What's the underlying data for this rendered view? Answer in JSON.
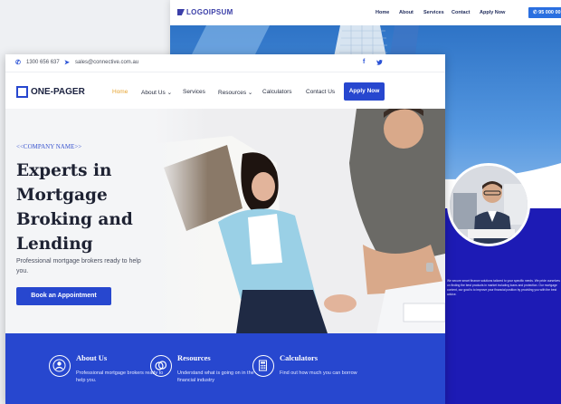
{
  "back_site": {
    "logo": "LOGOIPSUM",
    "nav": [
      "Home",
      "About",
      "Services",
      "Contact",
      "Apply Now"
    ],
    "phone": "95 000 00",
    "body_copy": "We secure smart finance solutions tailored to your specific needs. We pride ourselves on finding the best products in market including loans and protection. Our mortgage content, our goal is to improve your financial position by providing you with the best advice."
  },
  "topbar": {
    "phone": "1300 656 637",
    "email": "sales@connective.com.au",
    "facebook_icon": "f",
    "twitter_icon": "twitter-bird"
  },
  "nav": {
    "logo": "ONE-PAGER",
    "home": "Home",
    "about": "About Us",
    "services": "Services",
    "resources": "Resources",
    "calculators": "Calculators",
    "contact": "Contact Us",
    "apply": "Apply Now"
  },
  "hero": {
    "eyebrow": "<<COMPANY NAME>>",
    "headline": "Experts in Mortgage Broking and Lending",
    "subtext": "Professional mortgage brokers ready to help you.",
    "cta": "Book an Appointment"
  },
  "features": [
    {
      "title": "About Us",
      "desc": "Professional mortgage brokers ready to help you.",
      "icon": "user-icon"
    },
    {
      "title": "Resources",
      "desc": "Understand what is going on in the financial industry",
      "icon": "coins-icon"
    },
    {
      "title": "Calculators",
      "desc": "Find out how much you can borrow",
      "icon": "calculator-icon"
    }
  ],
  "colors": {
    "brand_blue": "#2747cf",
    "accent_orange": "#e6a431",
    "back_indigo": "#1d1bb5"
  }
}
